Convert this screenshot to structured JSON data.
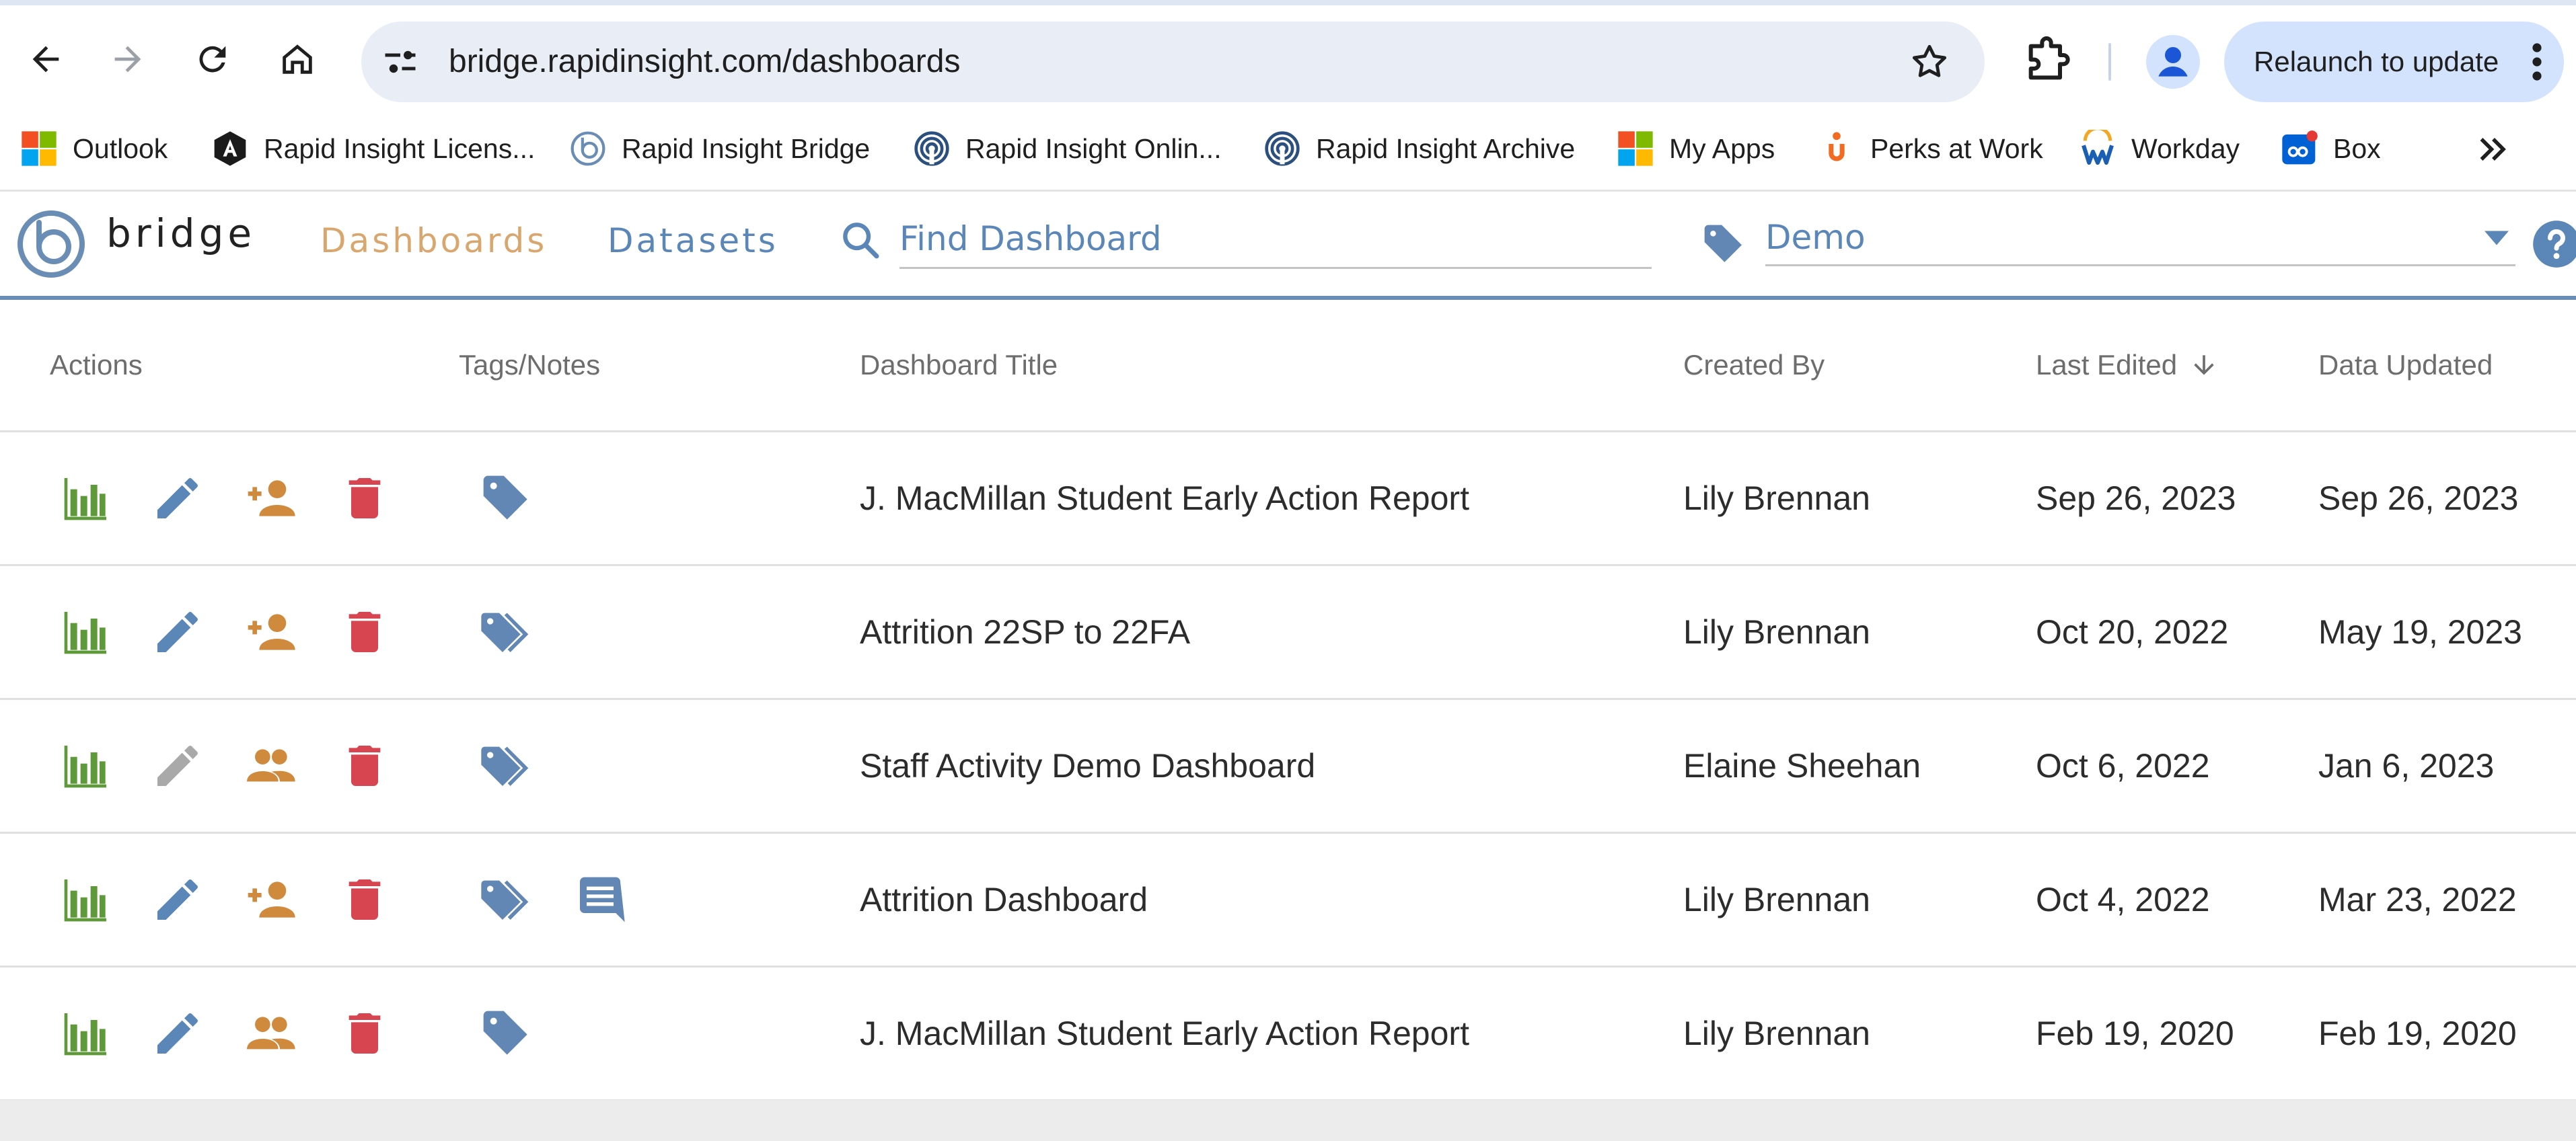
{
  "browser": {
    "url": "bridge.rapidinsight.com/dashboards",
    "relaunch_label": "Relaunch to update"
  },
  "bookmarks": [
    {
      "label": "Outlook",
      "icon": "microsoft-icon"
    },
    {
      "label": "Rapid Insight Licens...",
      "icon": "a-logo-icon"
    },
    {
      "label": "Rapid Insight Bridge",
      "icon": "bridge-logo-icon"
    },
    {
      "label": "Rapid Insight Onlin...",
      "icon": "rapid-insight-icon"
    },
    {
      "label": "Rapid Insight Archive",
      "icon": "rapid-insight-icon"
    },
    {
      "label": "My Apps",
      "icon": "microsoft-icon"
    },
    {
      "label": "Perks at Work",
      "icon": "perks-icon"
    },
    {
      "label": "Workday",
      "icon": "workday-icon"
    },
    {
      "label": "Box",
      "icon": "box-icon"
    }
  ],
  "app": {
    "logo_text": "bridge",
    "nav": {
      "dashboards": "Dashboards",
      "datasets": "Datasets"
    },
    "search_placeholder": "Find Dashboard",
    "tag_filter_value": "Demo"
  },
  "table": {
    "headers": {
      "actions": "Actions",
      "tags_notes": "Tags/Notes",
      "title": "Dashboard Title",
      "created_by": "Created By",
      "last_edited": "Last Edited",
      "data_updated": "Data Updated"
    },
    "rows": [
      {
        "title": "J. MacMillan Student Early Action Report",
        "created_by": "Lily Brennan",
        "last_edited": "Sep 26, 2023",
        "data_updated": "Sep 26, 2023",
        "edit_enabled": true,
        "share_icon": "person-add-icon",
        "tag_icon": "tag-icon",
        "has_note": false
      },
      {
        "title": "Attrition 22SP to 22FA",
        "created_by": "Lily Brennan",
        "last_edited": "Oct 20, 2022",
        "data_updated": "May 19, 2023",
        "edit_enabled": true,
        "share_icon": "person-add-icon",
        "tag_icon": "tags-icon",
        "has_note": false
      },
      {
        "title": "Staff Activity Demo Dashboard",
        "created_by": "Elaine Sheehan",
        "last_edited": "Oct 6, 2022",
        "data_updated": "Jan 6, 2023",
        "edit_enabled": false,
        "share_icon": "people-icon",
        "tag_icon": "tags-icon",
        "has_note": false
      },
      {
        "title": "Attrition Dashboard",
        "created_by": "Lily Brennan",
        "last_edited": "Oct 4, 2022",
        "data_updated": "Mar 23, 2022",
        "edit_enabled": true,
        "share_icon": "person-add-icon",
        "tag_icon": "tags-icon",
        "has_note": true
      },
      {
        "title": "J. MacMillan Student Early Action Report",
        "created_by": "Lily Brennan",
        "last_edited": "Feb 19, 2020",
        "data_updated": "Feb 19, 2020",
        "edit_enabled": true,
        "share_icon": "people-icon",
        "tag_icon": "tag-icon",
        "has_note": false
      }
    ]
  },
  "colors": {
    "chart_green": "#5f9a3a",
    "edit_blue": "#5b87b8",
    "edit_disabled": "#a9a9a9",
    "share_orange": "#d08a3e",
    "delete_red": "#d64550",
    "tag_blue": "#6287b4",
    "nav_active": "#d9a76d",
    "nav_inactive": "#5a86b8"
  }
}
